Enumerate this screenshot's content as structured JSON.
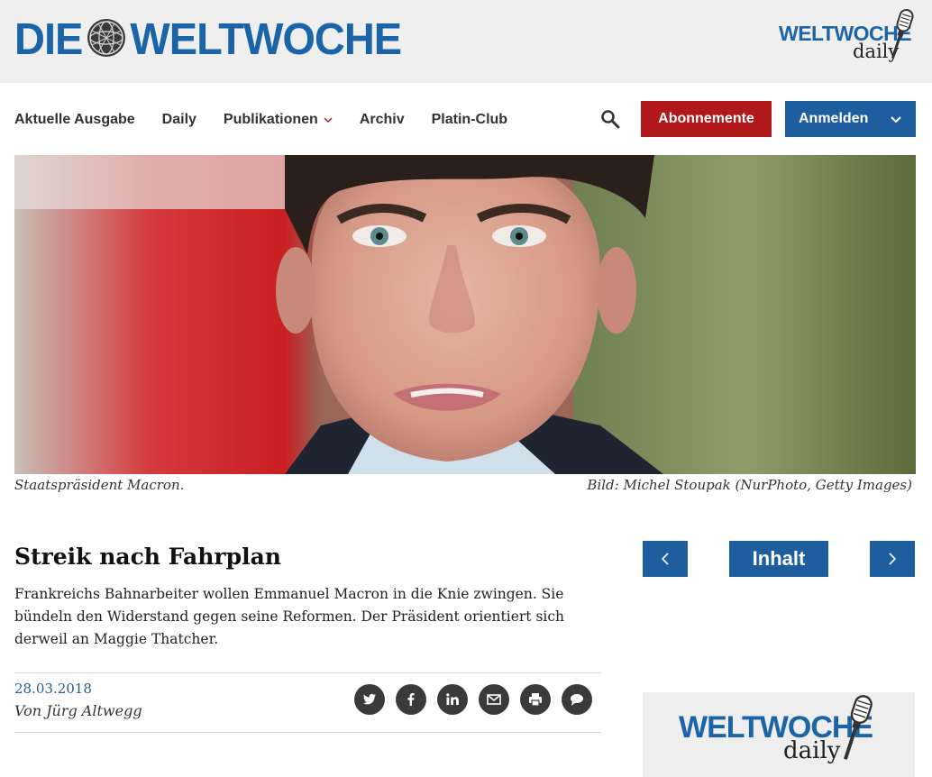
{
  "brand": {
    "logo_left": "DIE",
    "logo_right": "WELTWOCHE",
    "daily_word": "WELTWOCHE",
    "daily_sub": "daily",
    "color_primary": "#1c64a8",
    "color_red": "#b0181c"
  },
  "nav": {
    "items": [
      "Aktuelle Ausgabe",
      "Daily",
      "Publikationen",
      "Archiv",
      "Platin-Club"
    ],
    "subscribe_label": "Abonnemente",
    "login_label": "Anmelden",
    "search_icon": "search-icon"
  },
  "hero": {
    "caption": "Staatspräsident Macron.",
    "credit": "Bild: Michel Stoupak (NurPhoto, Getty Images)"
  },
  "article": {
    "title": "Streik nach Fahrplan",
    "lead": "Frankreichs Bahnarbeiter wollen Emmanuel Macron in die Knie zwingen. Sie bündeln den Widerstand gegen seine Reformen. Der Präsident orientiert sich derweil an Maggie Thatcher.",
    "date": "28.03.2018",
    "author": "Von Jürg Altwegg",
    "share_icons": [
      "twitter-icon",
      "facebook-icon",
      "linkedin-icon",
      "email-icon",
      "print-icon",
      "comment-icon"
    ]
  },
  "sidebar": {
    "prev_icon": "chevron-left-icon",
    "contents_label": "Inhalt",
    "next_icon": "chevron-right-icon",
    "promo_word": "WELTWOCHE",
    "promo_sub": "daily"
  }
}
